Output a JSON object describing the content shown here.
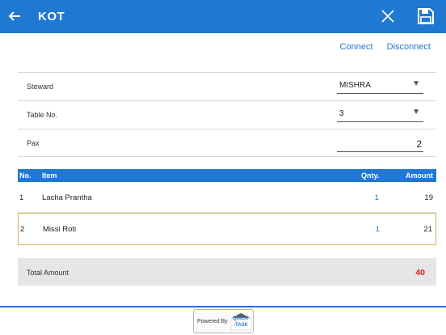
{
  "header": {
    "title": "KOT"
  },
  "actions": {
    "connect": "Connect",
    "disconnect": "Disconnect"
  },
  "form": {
    "steward": {
      "label": "Steward",
      "value": "MISHRA"
    },
    "table": {
      "label": "Table No.",
      "value": "3"
    },
    "pax": {
      "label": "Pax",
      "value": "2"
    }
  },
  "items": {
    "columns": {
      "no": "No.",
      "item": "Item",
      "qty": "Qnty.",
      "amount": "Amount"
    },
    "rows": [
      {
        "no": "1",
        "item": "Lacha Prantha",
        "qty": "1",
        "amount": "19"
      },
      {
        "no": "2",
        "item": "Missi Roti",
        "qty": "1",
        "amount": "21"
      }
    ]
  },
  "total": {
    "label": "Total Amount",
    "value": "40"
  },
  "footer": {
    "powered_by": "Powered By",
    "brand_line1": "QUICK",
    "brand_line2": "-TASK"
  },
  "colors": {
    "primary": "#1f78d1",
    "total_value": "#e01b1b",
    "selected_border": "#d7b25e"
  }
}
